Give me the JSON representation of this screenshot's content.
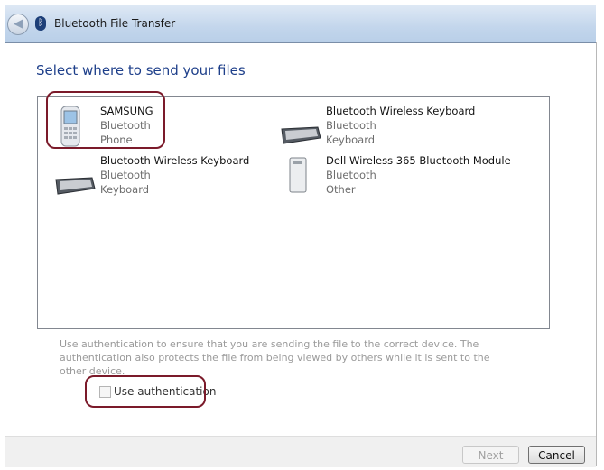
{
  "window": {
    "title": "Bluetooth File Transfer"
  },
  "heading": "Select where to send your files",
  "devices": [
    {
      "name": "SAMSUNG",
      "type": "Bluetooth",
      "category": "Phone",
      "icon": "phone-icon"
    },
    {
      "name": "Bluetooth Wireless Keyboard",
      "type": "Bluetooth",
      "category": "Keyboard",
      "icon": "keyboard-icon"
    },
    {
      "name": "Bluetooth Wireless Keyboard",
      "type": "Bluetooth",
      "category": "Keyboard",
      "icon": "keyboard-icon"
    },
    {
      "name": "Dell Wireless 365 Bluetooth Module",
      "type": "Bluetooth",
      "category": "Other",
      "icon": "device-icon"
    }
  ],
  "help_text": "Use authentication to ensure that you are sending the file to the correct device. The authentication also protects the file from being viewed by others while it is sent to the other device.",
  "auth_checkbox": {
    "label": "Use authentication",
    "checked": false
  },
  "buttons": {
    "next": "Next",
    "cancel": "Cancel"
  },
  "colors": {
    "heading": "#1e3f8a",
    "highlight": "#7b1a2a"
  }
}
